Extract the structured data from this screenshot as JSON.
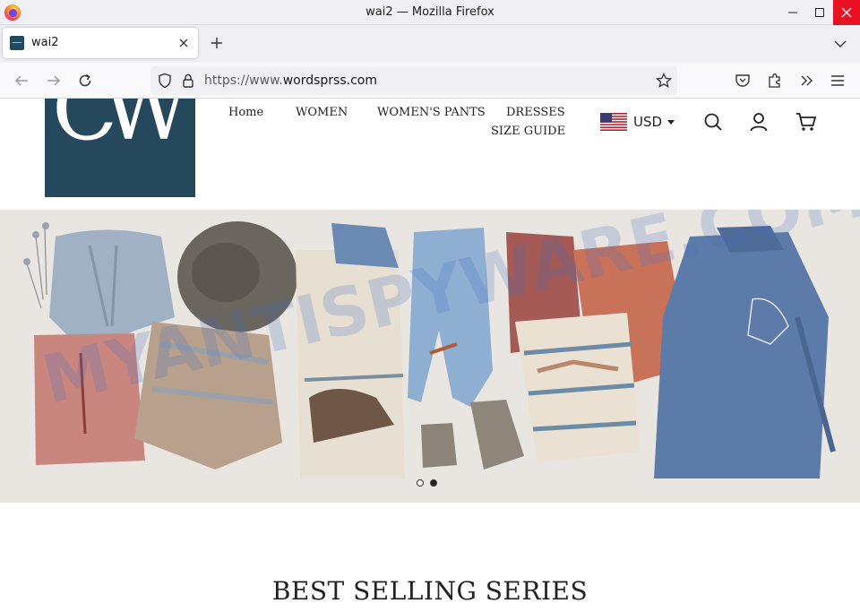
{
  "window": {
    "title": "wai2 — Mozilla Firefox"
  },
  "tabs": [
    {
      "title": "wai2",
      "favicon": "site-favicon"
    }
  ],
  "address_bar": {
    "url_prefix": "https://www.",
    "url_domain": "wordsprss.com"
  },
  "site": {
    "logo_text": "CW",
    "nav": {
      "home": "Home",
      "women": "WOMEN",
      "womens_pants": "WOMEN'S PANTS",
      "dresses": "DRESSES",
      "size_guide": "SIZE GUIDE"
    },
    "currency": "USD",
    "hero": {
      "watermark": "MYANTISPYWARE.COM",
      "slides": 2,
      "active_slide": 2
    },
    "section_title": "BEST SELLING SERIES"
  },
  "colors": {
    "logo_bg": "#26485c",
    "close_button": "#e81123",
    "hero_bg": "#e9e6e1"
  }
}
